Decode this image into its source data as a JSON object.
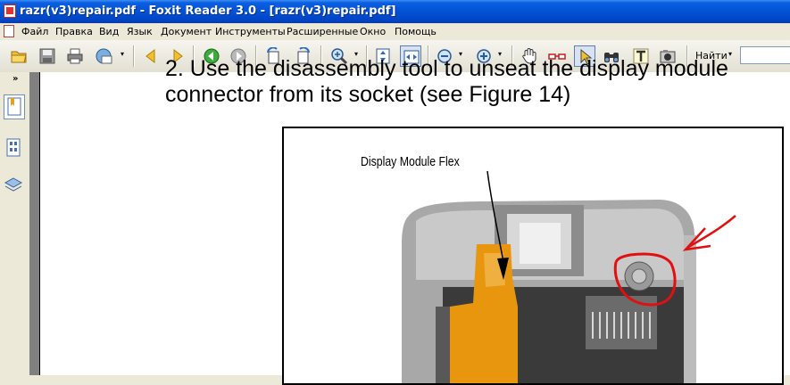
{
  "window": {
    "title": "razr(v3)repair.pdf - Foxit Reader 3.0 - [razr(v3)repair.pdf]"
  },
  "menu": {
    "items": [
      "Файл",
      "Правка",
      "Вид",
      "Язык",
      "Документ",
      "Инструменты",
      "Расширенные",
      "Окно",
      "Помощь"
    ]
  },
  "toolbar": {
    "icons": [
      "open-folder",
      "save",
      "print",
      "email",
      "prev-page",
      "next-page",
      "back",
      "forward",
      "rotate-left",
      "rotate-right",
      "zoom-in",
      "fit-page",
      "fit-width",
      "zoom-out",
      "zoom-plus",
      "hand-tool",
      "glasses",
      "select-arrow",
      "binoculars",
      "text-tool",
      "snapshot"
    ],
    "find_label": "Найти",
    "find_value": ""
  },
  "document": {
    "line1": "2. Use the disassembly tool to unseat the display module",
    "line2": "connector from its socket (see Figure 14)",
    "figure_label": "Display Module Flex"
  },
  "colors": {
    "titlebar": "#0352d6",
    "annotation": "#e01010",
    "flex": "#e8960e"
  }
}
